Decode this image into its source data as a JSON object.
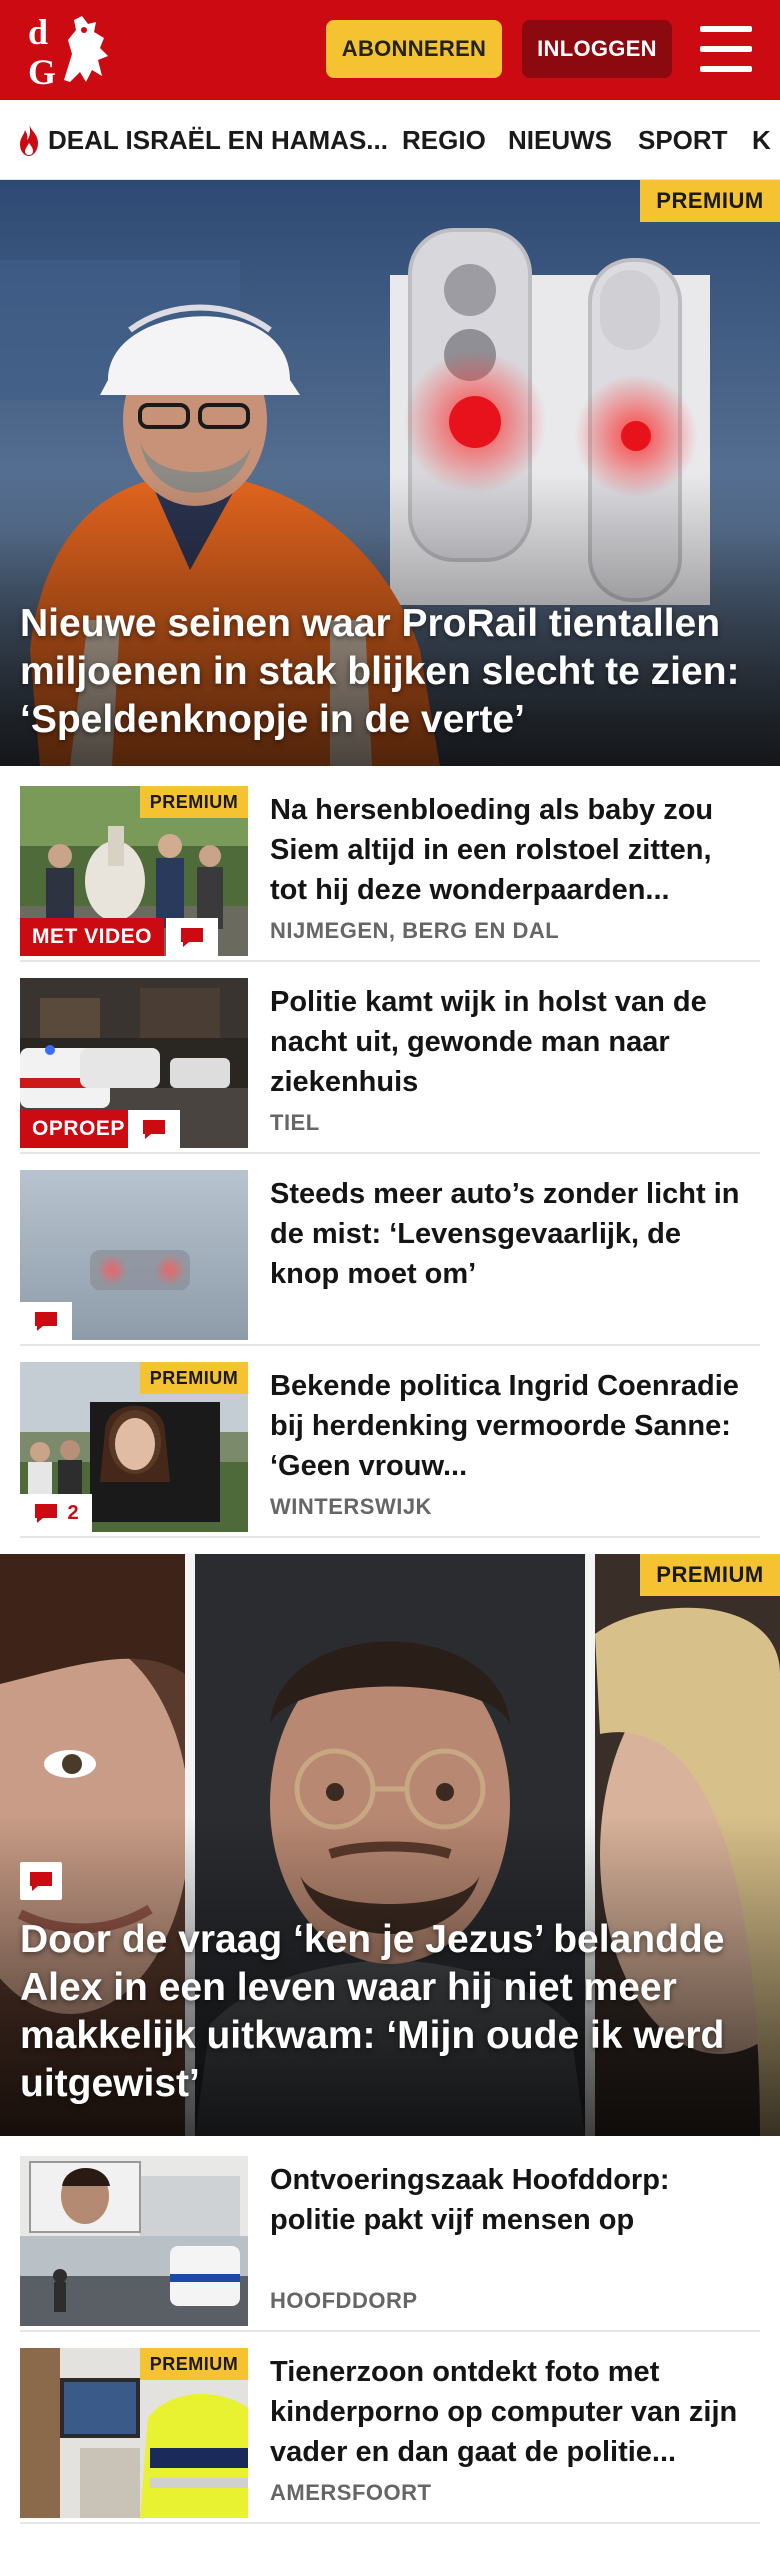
{
  "header": {
    "logo_text": "dG",
    "subscribe_label": "ABONNEREN",
    "login_label": "INLOGGEN"
  },
  "nav": {
    "items": [
      {
        "label": "DEAL ISRAËL EN HAMAS..."
      },
      {
        "label": "REGIO"
      },
      {
        "label": "NIEUWS"
      },
      {
        "label": "SPORT"
      },
      {
        "label": "K"
      }
    ]
  },
  "hero1": {
    "badge": "PREMIUM",
    "headline": "Nieuwe seinen waar ProRail tientallen miljoenen in stak blijken slecht te zien: ‘Speldenknopje in de verte’"
  },
  "articles_a": [
    {
      "badge": "PREMIUM",
      "label": "MET VIDEO",
      "title": "Na hersenbloeding als baby zou Siem altijd in een rolstoel zitten, tot hij deze wonderpaarden...",
      "location": "NIJMEGEN, BERG EN DAL"
    },
    {
      "badge": "",
      "label": "OPROEP",
      "title": "Politie kamt wijk in holst van de nacht uit, gewonde man naar ziekenhuis",
      "location": "TIEL"
    },
    {
      "badge": "",
      "label": "",
      "title": "Steeds meer auto’s zonder licht in de mist: ‘Levensgevaarlijk, de knop moet om’",
      "location": ""
    },
    {
      "badge": "PREMIUM",
      "label": "",
      "comment_count": "2",
      "title": "Bekende politica Ingrid Coenradie bij herdenking vermoorde Sanne: ‘Geen vrouw...",
      "location": "WINTERSWIJK"
    }
  ],
  "hero2": {
    "badge": "PREMIUM",
    "headline": "Door de vraag ‘ken je Jezus’ belandde Alex in een leven waar hij niet meer makkelijk uitkwam: ‘Mijn oude ik werd uitgewist’"
  },
  "articles_b": [
    {
      "badge": "",
      "title": "Ontvoeringszaak Hoofddorp: politie pakt vijf mensen op",
      "location": "HOOFDDORP"
    },
    {
      "badge": "PREMIUM",
      "title": "Tienerzoon ontdekt foto met kinderporno op computer van zijn vader en dan gaat de politie...",
      "location": "AMERSFOORT"
    }
  ],
  "colors": {
    "brand_red": "#cc0a12",
    "premium_yellow": "#f5c231",
    "login_dark_red": "#8d0910"
  }
}
